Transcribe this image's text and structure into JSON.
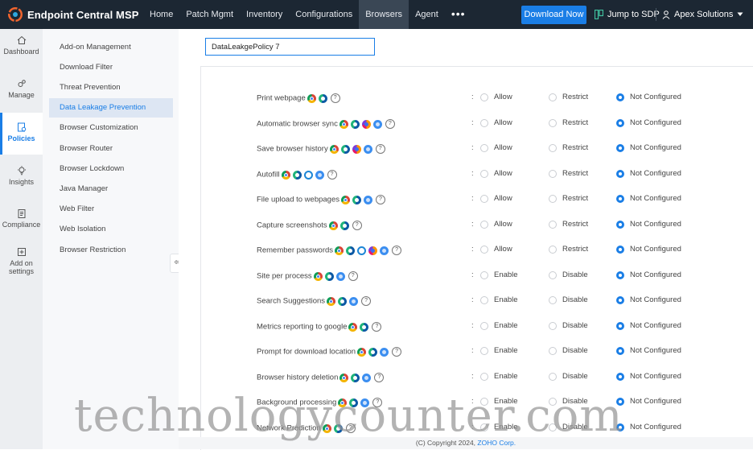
{
  "brand": {
    "name": "Endpoint Central MSP"
  },
  "nav": {
    "items": [
      {
        "label": "Home",
        "active": false
      },
      {
        "label": "Patch Mgmt",
        "active": false
      },
      {
        "label": "Inventory",
        "active": false
      },
      {
        "label": "Configurations",
        "active": false
      },
      {
        "label": "Browsers",
        "active": true
      },
      {
        "label": "Agent",
        "active": false
      }
    ],
    "more": "•••"
  },
  "header": {
    "download_label": "Download Now",
    "jump_label": "Jump to SDP",
    "account_label": "Apex Solutions"
  },
  "rail": {
    "items": [
      {
        "label": "Dashboard",
        "icon": "home-icon"
      },
      {
        "label": "Manage",
        "icon": "gears-icon"
      },
      {
        "label": "Policies",
        "icon": "policy-icon",
        "active": true
      },
      {
        "label": "Insights",
        "icon": "bulb-icon"
      },
      {
        "label": "Compliance",
        "icon": "clipboard-icon"
      },
      {
        "label": "Add on settings",
        "icon": "addon-icon"
      }
    ]
  },
  "subnav": {
    "items": [
      {
        "label": "Add-on Management"
      },
      {
        "label": "Download Filter"
      },
      {
        "label": "Threat Prevention"
      },
      {
        "label": "Data Leakage Prevention",
        "active": true
      },
      {
        "label": "Browser Customization"
      },
      {
        "label": "Browser Router"
      },
      {
        "label": "Browser Lockdown"
      },
      {
        "label": "Java Manager"
      },
      {
        "label": "Web Filter"
      },
      {
        "label": "Web Isolation"
      },
      {
        "label": "Browser Restriction"
      }
    ]
  },
  "policy": {
    "name": "DataLeakgePolicy 7"
  },
  "settings": [
    {
      "label": "Print webpage",
      "browsers": [
        "chrome",
        "edge"
      ],
      "options": [
        "Allow",
        "Restrict",
        "Not Configured"
      ],
      "selected": 2
    },
    {
      "label": "Automatic browser sync",
      "browsers": [
        "chrome",
        "edge",
        "firefox",
        "safari"
      ],
      "options": [
        "Allow",
        "Restrict",
        "Not Configured"
      ],
      "selected": 2
    },
    {
      "label": "Save browser history",
      "browsers": [
        "chrome",
        "edge",
        "firefox",
        "safari"
      ],
      "options": [
        "Allow",
        "Restrict",
        "Not Configured"
      ],
      "selected": 2
    },
    {
      "label": "Autofill",
      "browsers": [
        "chrome",
        "edge",
        "ie",
        "safari"
      ],
      "options": [
        "Allow",
        "Restrict",
        "Not Configured"
      ],
      "selected": 2
    },
    {
      "label": "File upload to webpages",
      "browsers": [
        "chrome",
        "edge",
        "safari"
      ],
      "options": [
        "Allow",
        "Restrict",
        "Not Configured"
      ],
      "selected": 2
    },
    {
      "label": "Capture screenshots",
      "browsers": [
        "chrome",
        "edge"
      ],
      "options": [
        "Allow",
        "Restrict",
        "Not Configured"
      ],
      "selected": 2
    },
    {
      "label": "Remember passwords",
      "browsers": [
        "chrome",
        "edge",
        "ie",
        "firefox",
        "safari"
      ],
      "options": [
        "Allow",
        "Restrict",
        "Not Configured"
      ],
      "selected": 2
    },
    {
      "label": "Site per process",
      "browsers": [
        "chrome",
        "edge",
        "safari"
      ],
      "options": [
        "Enable",
        "Disable",
        "Not Configured"
      ],
      "selected": 2
    },
    {
      "label": "Search Suggestions",
      "browsers": [
        "chrome",
        "edge",
        "safari"
      ],
      "options": [
        "Enable",
        "Disable",
        "Not Configured"
      ],
      "selected": 2
    },
    {
      "label": "Metrics reporting to google",
      "browsers": [
        "chrome",
        "edge"
      ],
      "options": [
        "Enable",
        "Disable",
        "Not Configured"
      ],
      "selected": 2
    },
    {
      "label": "Prompt for download location",
      "browsers": [
        "chrome",
        "edge",
        "safari"
      ],
      "options": [
        "Enable",
        "Disable",
        "Not Configured"
      ],
      "selected": 2
    },
    {
      "label": "Browser history deletion",
      "browsers": [
        "chrome",
        "edge",
        "safari"
      ],
      "options": [
        "Enable",
        "Disable",
        "Not Configured"
      ],
      "selected": 2
    },
    {
      "label": "Background processing",
      "browsers": [
        "chrome",
        "edge",
        "safari"
      ],
      "options": [
        "Enable",
        "Disable",
        "Not Configured"
      ],
      "selected": 2
    },
    {
      "label": "Network Prediction",
      "browsers": [
        "chrome",
        "edge"
      ],
      "options": [
        "Enable",
        "Disable",
        "Not Configured"
      ],
      "selected": 2
    }
  ],
  "footer": {
    "copyright": "(C) Copyright 2024,",
    "company": "ZOHO Corp."
  },
  "watermark": "technologycounter.com",
  "colors": {
    "topbar": "#1c2733",
    "accent": "#1a7ee6",
    "active_nav": "#3a4755"
  }
}
